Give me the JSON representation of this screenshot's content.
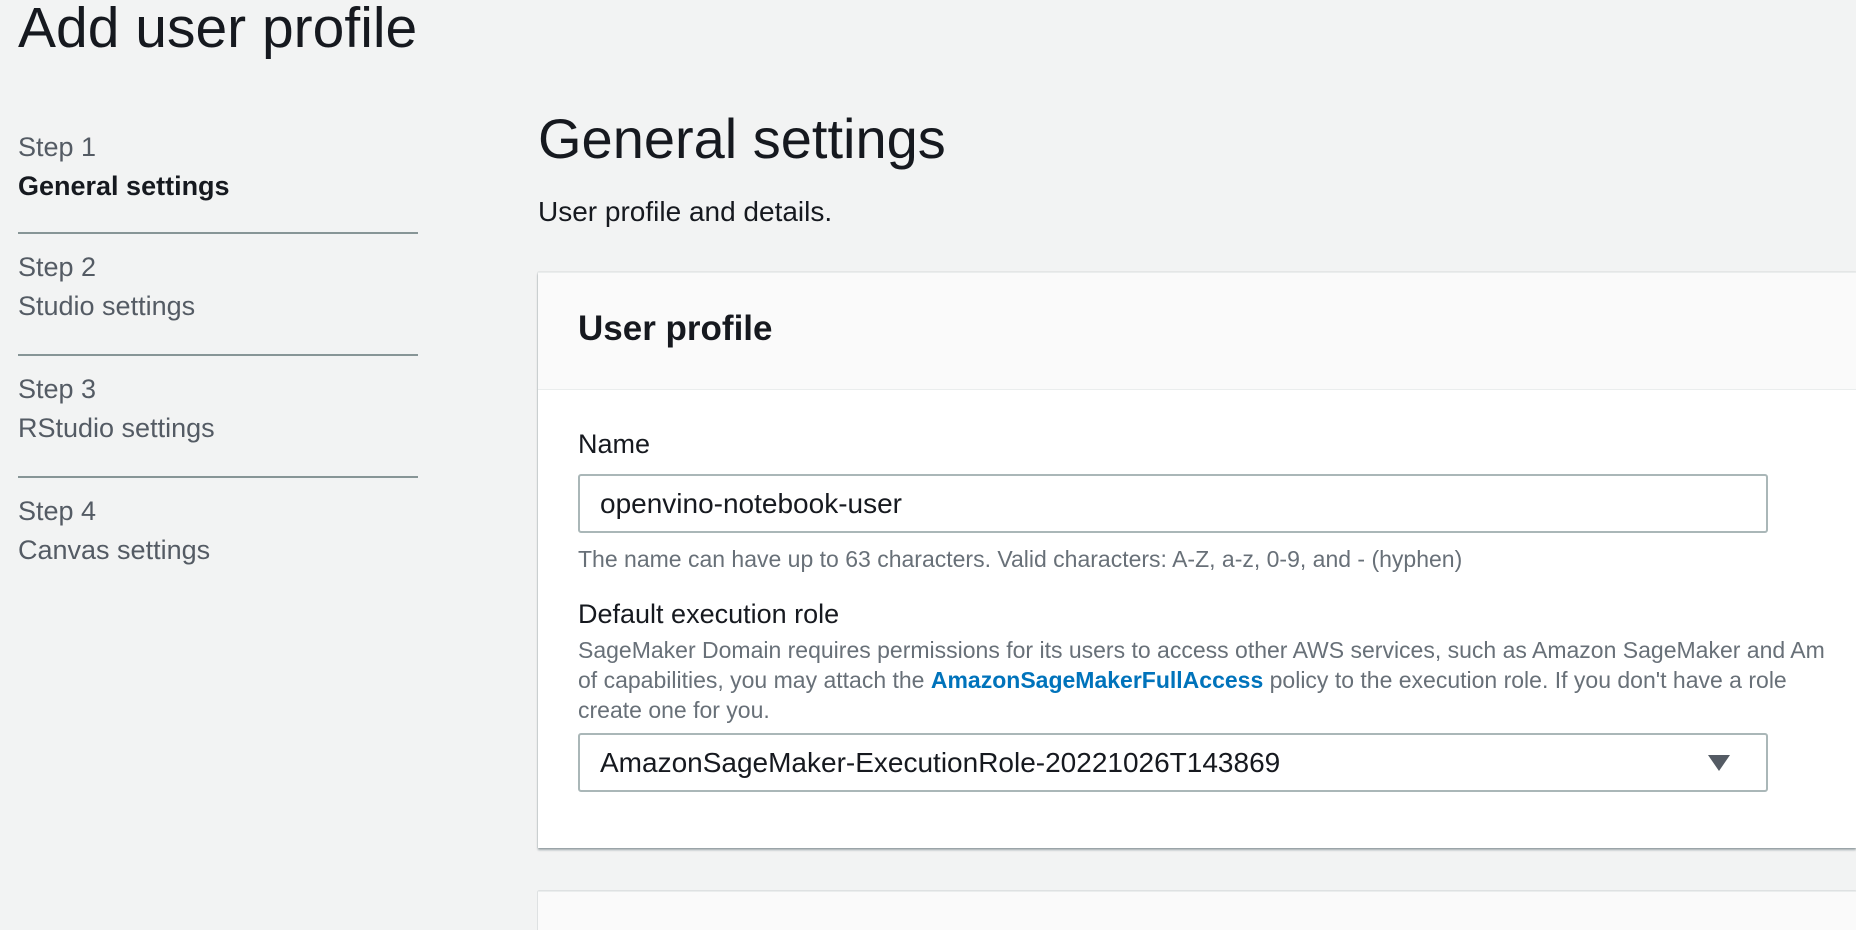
{
  "page": {
    "title": "Add user profile"
  },
  "steps": [
    {
      "number": "Step 1",
      "label": "General settings",
      "active": true
    },
    {
      "number": "Step 2",
      "label": "Studio settings",
      "active": false
    },
    {
      "number": "Step 3",
      "label": "RStudio settings",
      "active": false
    },
    {
      "number": "Step 4",
      "label": "Canvas settings",
      "active": false
    }
  ],
  "main": {
    "heading": "General settings",
    "subtitle": "User profile and details."
  },
  "user_profile": {
    "title": "User profile",
    "name": {
      "label": "Name",
      "value": "openvino-notebook-user",
      "hint": "The name can have up to 63 characters. Valid characters: A-Z, a-z, 0-9, and - (hyphen)"
    },
    "execution_role": {
      "label": "Default execution role",
      "desc_line1": "SageMaker Domain requires permissions for its users to access other AWS services, such as Amazon SageMaker and Am",
      "desc_line2_before": "of capabilities, you may attach the ",
      "desc_link": "AmazonSageMakerFullAccess",
      "desc_line2_after": " policy to the execution role. If you don't have a role",
      "desc_line3": "create one for you.",
      "selected": "AmazonSageMaker-ExecutionRole-20221026T143869"
    }
  },
  "icons": {
    "select_caret": "caret-down-icon"
  }
}
